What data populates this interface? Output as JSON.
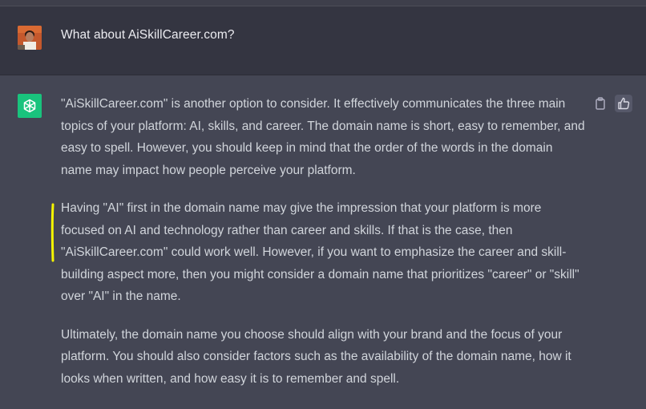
{
  "conversation": {
    "user_message": "What about AiSkillCareer.com?",
    "assistant_paragraphs": [
      "\"AiSkillCareer.com\" is another option to consider. It effectively communicates the three main topics of your platform: AI, skills, and career. The domain name is short, easy to remember, and easy to spell. However, you should keep in mind that the order of the words in the domain name may impact how people perceive your platform.",
      "Having \"AI\" first in the domain name may give the impression that your platform is more focused on AI and technology rather than career and skills. If that is the case, then \"AiSkillCareer.com\" could work well. However, if you want to emphasize the career and skill-building aspect more, then you might consider a domain name that prioritizes \"career\" or \"skill\" over \"AI\" in the name.",
      "Ultimately, the domain name you choose should align with your brand and the focus of your platform. You should also consider factors such as the availability of the domain name, how it looks when written, and how easy it is to remember and spell."
    ]
  },
  "icons": {
    "user_avatar": "user-avatar-photo",
    "assistant_avatar": "openai-logo-icon",
    "copy": "clipboard-icon",
    "feedback": "thumbs-up-icon",
    "annotation": "yellow-highlight-mark"
  },
  "colors": {
    "user_row_bg": "#343541",
    "assistant_row_bg": "#444654",
    "assistant_avatar_bg": "#19c37d",
    "text": "#d1d5db",
    "highlight": "#f5f500"
  }
}
